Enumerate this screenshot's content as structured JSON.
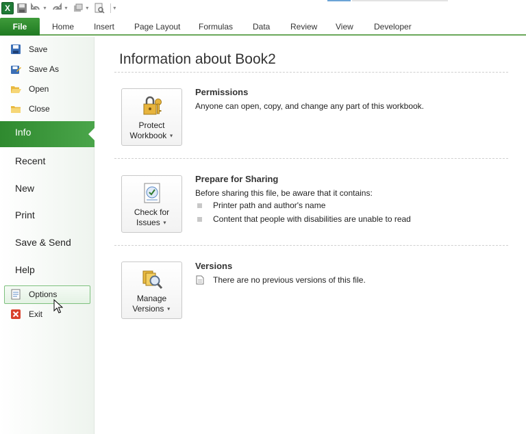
{
  "ribbon": {
    "file_tab": "File",
    "tabs": [
      "Home",
      "Insert",
      "Page Layout",
      "Formulas",
      "Data",
      "Review",
      "View",
      "Developer"
    ]
  },
  "quick_access": {
    "icons": [
      "excel-logo-icon",
      "save-icon",
      "undo-icon",
      "redo-icon",
      "customize-icon",
      "print-preview-icon"
    ],
    "logo_letter": "X"
  },
  "nav": {
    "commands": [
      {
        "label": "Save",
        "icon": "save-icon"
      },
      {
        "label": "Save As",
        "icon": "save-as-icon"
      },
      {
        "label": "Open",
        "icon": "open-folder-icon"
      },
      {
        "label": "Close",
        "icon": "close-folder-icon"
      }
    ],
    "selected": "Info",
    "tabs": [
      "Recent",
      "New",
      "Print",
      "Save & Send",
      "Help"
    ],
    "bottom_commands": [
      {
        "label": "Options",
        "icon": "options-icon"
      },
      {
        "label": "Exit",
        "icon": "exit-icon"
      }
    ]
  },
  "main": {
    "title": "Information about Book2",
    "sections": [
      {
        "button_line1": "Protect",
        "button_line2": "Workbook",
        "icon": "lock-keys-icon",
        "title": "Permissions",
        "text": "Anyone can open, copy, and change any part of this workbook."
      },
      {
        "button_line1": "Check for",
        "button_line2": "Issues",
        "icon": "checklist-icon",
        "title": "Prepare for Sharing",
        "text": "Before sharing this file, be aware that it contains:",
        "bullets": [
          "Printer path and author's name",
          "Content that people with disabilities are unable to read"
        ]
      },
      {
        "button_line1": "Manage",
        "button_line2": "Versions",
        "icon": "versions-icon",
        "title": "Versions",
        "text": "There are no previous versions of this file."
      }
    ]
  },
  "colors": {
    "accent_green": "#2f8a2f",
    "file_tab_green": "#1f7a22"
  }
}
